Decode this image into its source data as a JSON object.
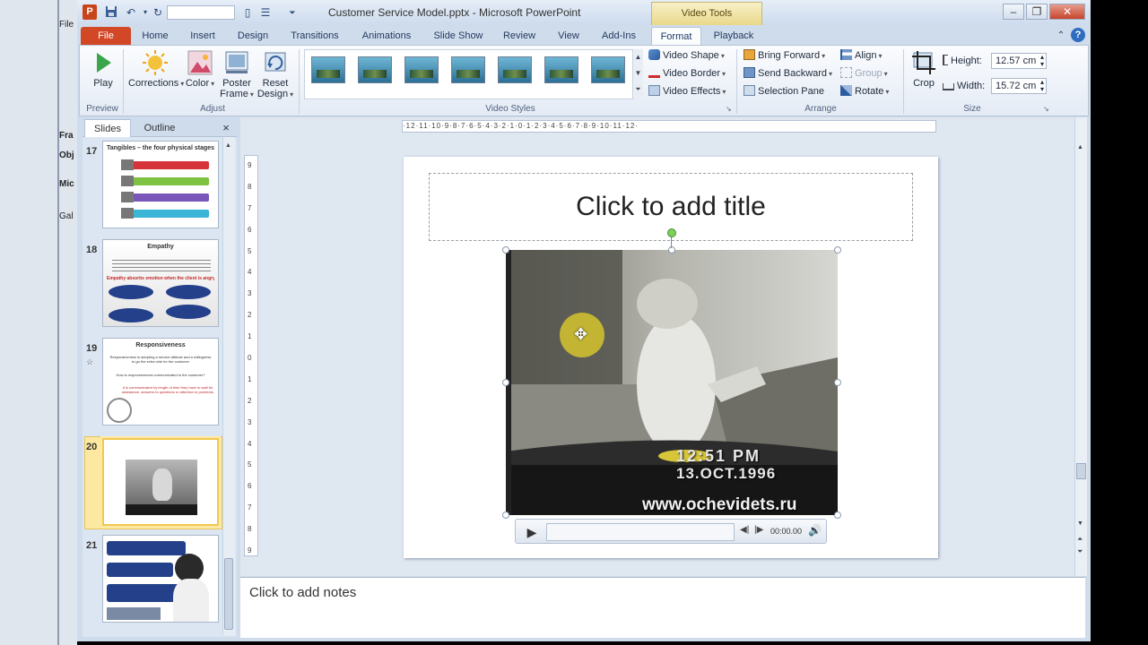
{
  "window": {
    "title": "Customer Service Model.pptx - Microsoft PowerPoint",
    "app_icon_label": "P",
    "contextual_tab_group": "Video Tools"
  },
  "background_app": {
    "fragments": [
      "File",
      "Fra",
      "Obj",
      "Mic",
      "Gal"
    ]
  },
  "tabs": [
    "File",
    "Home",
    "Insert",
    "Design",
    "Transitions",
    "Animations",
    "Slide Show",
    "Review",
    "View",
    "Add-Ins",
    "Format",
    "Playback"
  ],
  "active_tab": "Format",
  "ribbon": {
    "preview": {
      "label": "Preview",
      "play": "Play"
    },
    "adjust": {
      "label": "Adjust",
      "corrections": "Corrections",
      "color": "Color",
      "poster_frame_1": "Poster",
      "poster_frame_2": "Frame",
      "reset_design_1": "Reset",
      "reset_design_2": "Design"
    },
    "video_styles": {
      "label": "Video Styles",
      "video_shape": "Video Shape",
      "video_border": "Video Border",
      "video_effects": "Video Effects"
    },
    "arrange": {
      "label": "Arrange",
      "bring_forward": "Bring Forward",
      "send_backward": "Send Backward",
      "selection_pane": "Selection Pane",
      "align": "Align",
      "group": "Group",
      "rotate": "Rotate"
    },
    "size": {
      "label": "Size",
      "crop": "Crop",
      "height_label": "Height:",
      "height_value": "12.57 cm",
      "width_label": "Width:",
      "width_value": "15.72 cm"
    }
  },
  "slides_panel": {
    "tab_slides": "Slides",
    "tab_outline": "Outline",
    "close": "×",
    "slides": [
      {
        "num": "17",
        "title": "Tangibles – the four physical stages"
      },
      {
        "num": "18",
        "title": "Empathy",
        "highlight": "Empathy absorbs emotion when the client is angry"
      },
      {
        "num": "19",
        "title": "Responsiveness",
        "line1": "Responsiveness is adopting a service attitude and a willingness to go the extra mile for the customer",
        "line2": "How is responsiveness communicated to the customer?",
        "line3": "It is communicated by length of time they have to wait for assistance, answers to questions or attention to problems"
      },
      {
        "num": "20"
      },
      {
        "num": "21"
      }
    ]
  },
  "ruler": {
    "horizontal": "·12·11·10·9·8·7·6·5·4·3·2·1·0·1·2·3·4·5·6·7·8·9·10·11·12·",
    "vertical": [
      "9",
      "8",
      "7",
      "6",
      "5",
      "4",
      "3",
      "2",
      "1",
      "0",
      "1",
      "2",
      "3",
      "4",
      "5",
      "6",
      "7",
      "8",
      "9"
    ]
  },
  "slide": {
    "title_placeholder": "Click to add title",
    "video": {
      "timestamp_time": "12:51 PM",
      "timestamp_date": "13.OCT.1996",
      "watermark": "www.ochevidets.ru"
    },
    "player": {
      "time": "00:00.00"
    }
  },
  "notes": {
    "placeholder": "Click to add notes"
  }
}
